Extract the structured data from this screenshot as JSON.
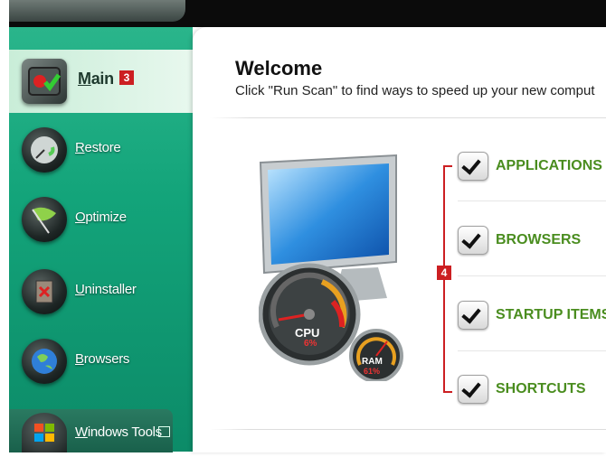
{
  "window": {
    "title_tab": ""
  },
  "sidebar": {
    "items": [
      {
        "label": "Main",
        "icon": "system-cube-icon",
        "active": true
      },
      {
        "label": "Restore",
        "icon": "restore-gauge-icon"
      },
      {
        "label": "Optimize",
        "icon": "optimize-flag-icon"
      },
      {
        "label": "Uninstaller",
        "icon": "uninstaller-icon"
      },
      {
        "label": "Browsers",
        "icon": "globe-icon"
      },
      {
        "label": "Windows Tools",
        "icon": "windows-logo-icon"
      }
    ]
  },
  "callouts": {
    "main_badge": "3",
    "checklist_badge": "4"
  },
  "main": {
    "title": "Welcome",
    "subtitle": "Click \"Run Scan\" to find ways to speed up your new comput",
    "gauges": {
      "cpu_label": "CPU",
      "cpu_value": "6%",
      "ram_label": "RAM",
      "ram_value": "61%"
    },
    "checklist": [
      {
        "label": "APPLICATIONS",
        "checked": true
      },
      {
        "label": "BROWSERS",
        "checked": true
      },
      {
        "label": "STARTUP ITEMS",
        "checked": true
      },
      {
        "label": "SHORTCUTS",
        "checked": true
      }
    ]
  },
  "colors": {
    "accent_green": "#4a8d1f",
    "callout_red": "#cc1f22",
    "sidebar_green": "#13a47a"
  }
}
